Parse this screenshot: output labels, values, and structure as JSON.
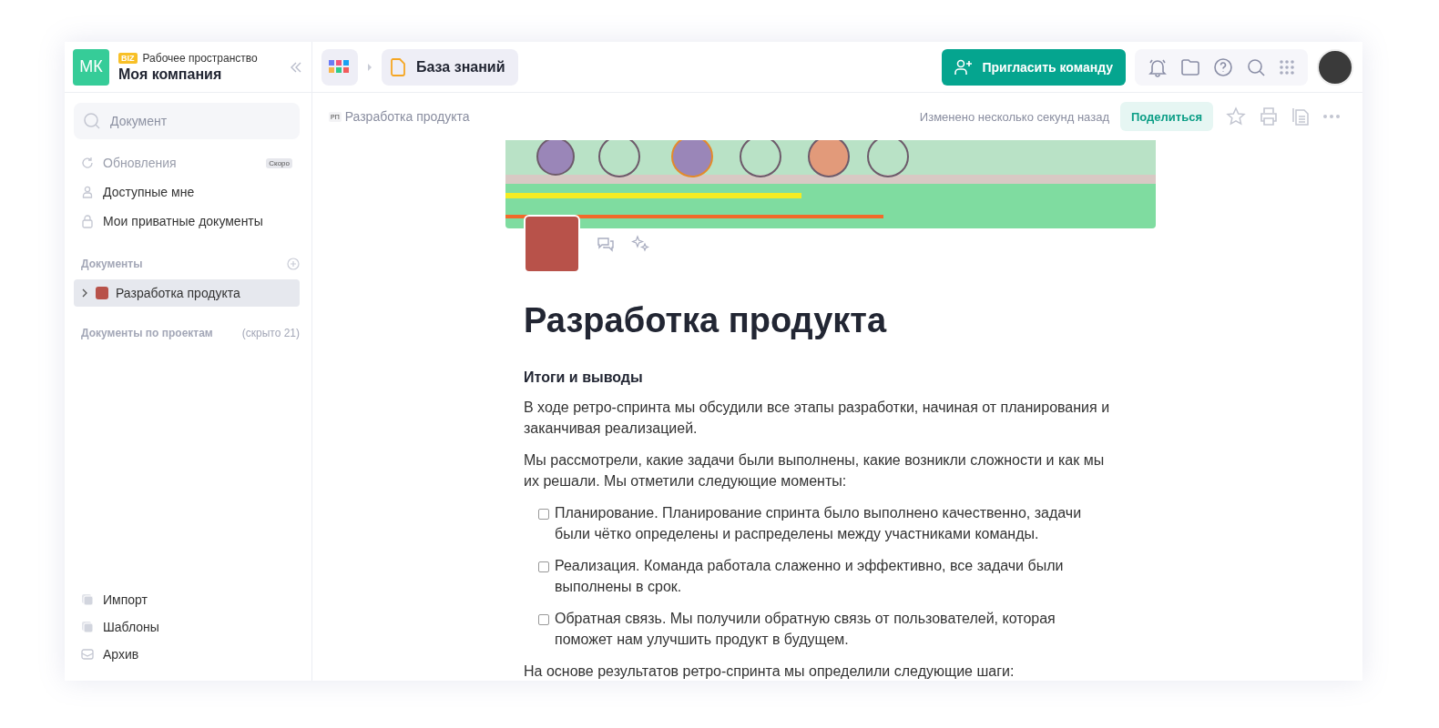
{
  "workspace": {
    "initials": "МК",
    "badge": "BIZ",
    "label": "Рабочее пространство",
    "name": "Моя компания"
  },
  "sidebar": {
    "search": {
      "placeholder": "Документ"
    },
    "nav_items": [
      {
        "kind": "refresh",
        "label": "Обновления",
        "disabled": true,
        "badge": "Скоро"
      },
      {
        "kind": "person",
        "label": "Доступные мне",
        "disabled": false
      },
      {
        "kind": "lock",
        "label": "Мои приватные документы",
        "disabled": false
      }
    ],
    "documents_header": "Документы",
    "documents": [
      {
        "label": "Разработка продукта",
        "expanded": false,
        "selected": true
      }
    ],
    "projects_header": "Документы по проектам",
    "projects_hidden": "(скрыто 21)",
    "footer_items": [
      {
        "kind": "stack",
        "label": "Импорт"
      },
      {
        "kind": "stack",
        "label": "Шаблоны"
      },
      {
        "kind": "inbox",
        "label": "Архив"
      }
    ]
  },
  "topbar": {
    "breadcrumb": "База знаний",
    "invite_button": "Пригласить команду"
  },
  "document": {
    "breadcrumb_abbr": "РП",
    "breadcrumb": "Разработка продукта",
    "modified": "Изменено несколько секунд назад",
    "share_button": "Поделиться",
    "title": "Разработка продукта",
    "blocks": [
      {
        "kind": "heading",
        "text": "Итоги и выводы"
      },
      {
        "kind": "paragraph",
        "text": "В ходе ретро-спринта мы обсудили все этапы разработки, начиная от планирования и заканчивая реализацией."
      },
      {
        "kind": "paragraph",
        "text": "Мы рассмотрели, какие задачи были выполнены, какие возникли сложности и как мы их решали. Мы отметили следующие моменты:"
      },
      {
        "kind": "todo",
        "text": "Планирование. Планирование спринта было выполнено качественно, задачи были чётко определены и распределены между участниками команды.",
        "checked": false
      },
      {
        "kind": "todo",
        "text": "Реализация. Команда работала слаженно и эффективно, все задачи были выполнены в срок.",
        "checked": false
      },
      {
        "kind": "todo",
        "text": "Обратная связь. Мы получили обратную связь от пользователей, которая поможет нам улучшить продукт в будущем.",
        "checked": false
      },
      {
        "kind": "paragraph",
        "text": "На основе результатов ретро-спринта мы определили следующие шаги:"
      }
    ]
  }
}
